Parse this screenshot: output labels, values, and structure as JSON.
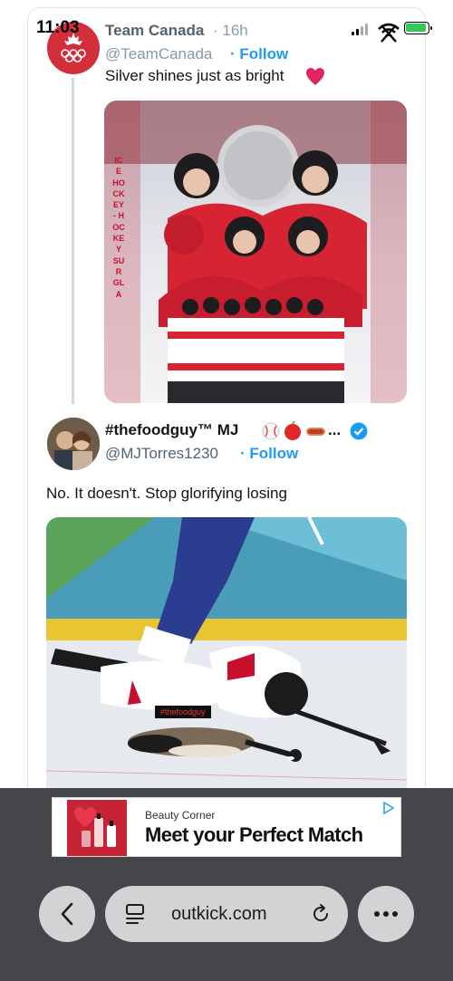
{
  "status_bar": {
    "time": "11:03",
    "icons": [
      "signal-icon",
      "wifi-off-icon",
      "battery-charging-icon"
    ]
  },
  "tweet_main": {
    "author_name": "Team Canada",
    "time": "· 16h",
    "handle": "@TeamCanada",
    "follow_label": "· Follow",
    "text": "Silver shines just as bright",
    "emoji": "red-heart",
    "image_vertical_text": "ICE HOCKEY - HOCKEY SUR GLA"
  },
  "tweet_reply": {
    "author_name": "#thefoodguy™ MJ",
    "name_emojis": [
      "baseball",
      "apple",
      "hotdog"
    ],
    "more": "...",
    "verified": true,
    "handle": "@MJTorres1230",
    "follow_label": "· Follow",
    "text": "No. It doesn't. Stop glorifying losing",
    "image_watermark": "#thefoodguy"
  },
  "ad": {
    "source": "Beauty Corner",
    "title": "Meet your Perfect Match"
  },
  "browser": {
    "url": "outkick.com"
  },
  "colors": {
    "follow": "#1d9bf0",
    "canada_red": "#d32f3a",
    "toolbar": "#444649"
  }
}
